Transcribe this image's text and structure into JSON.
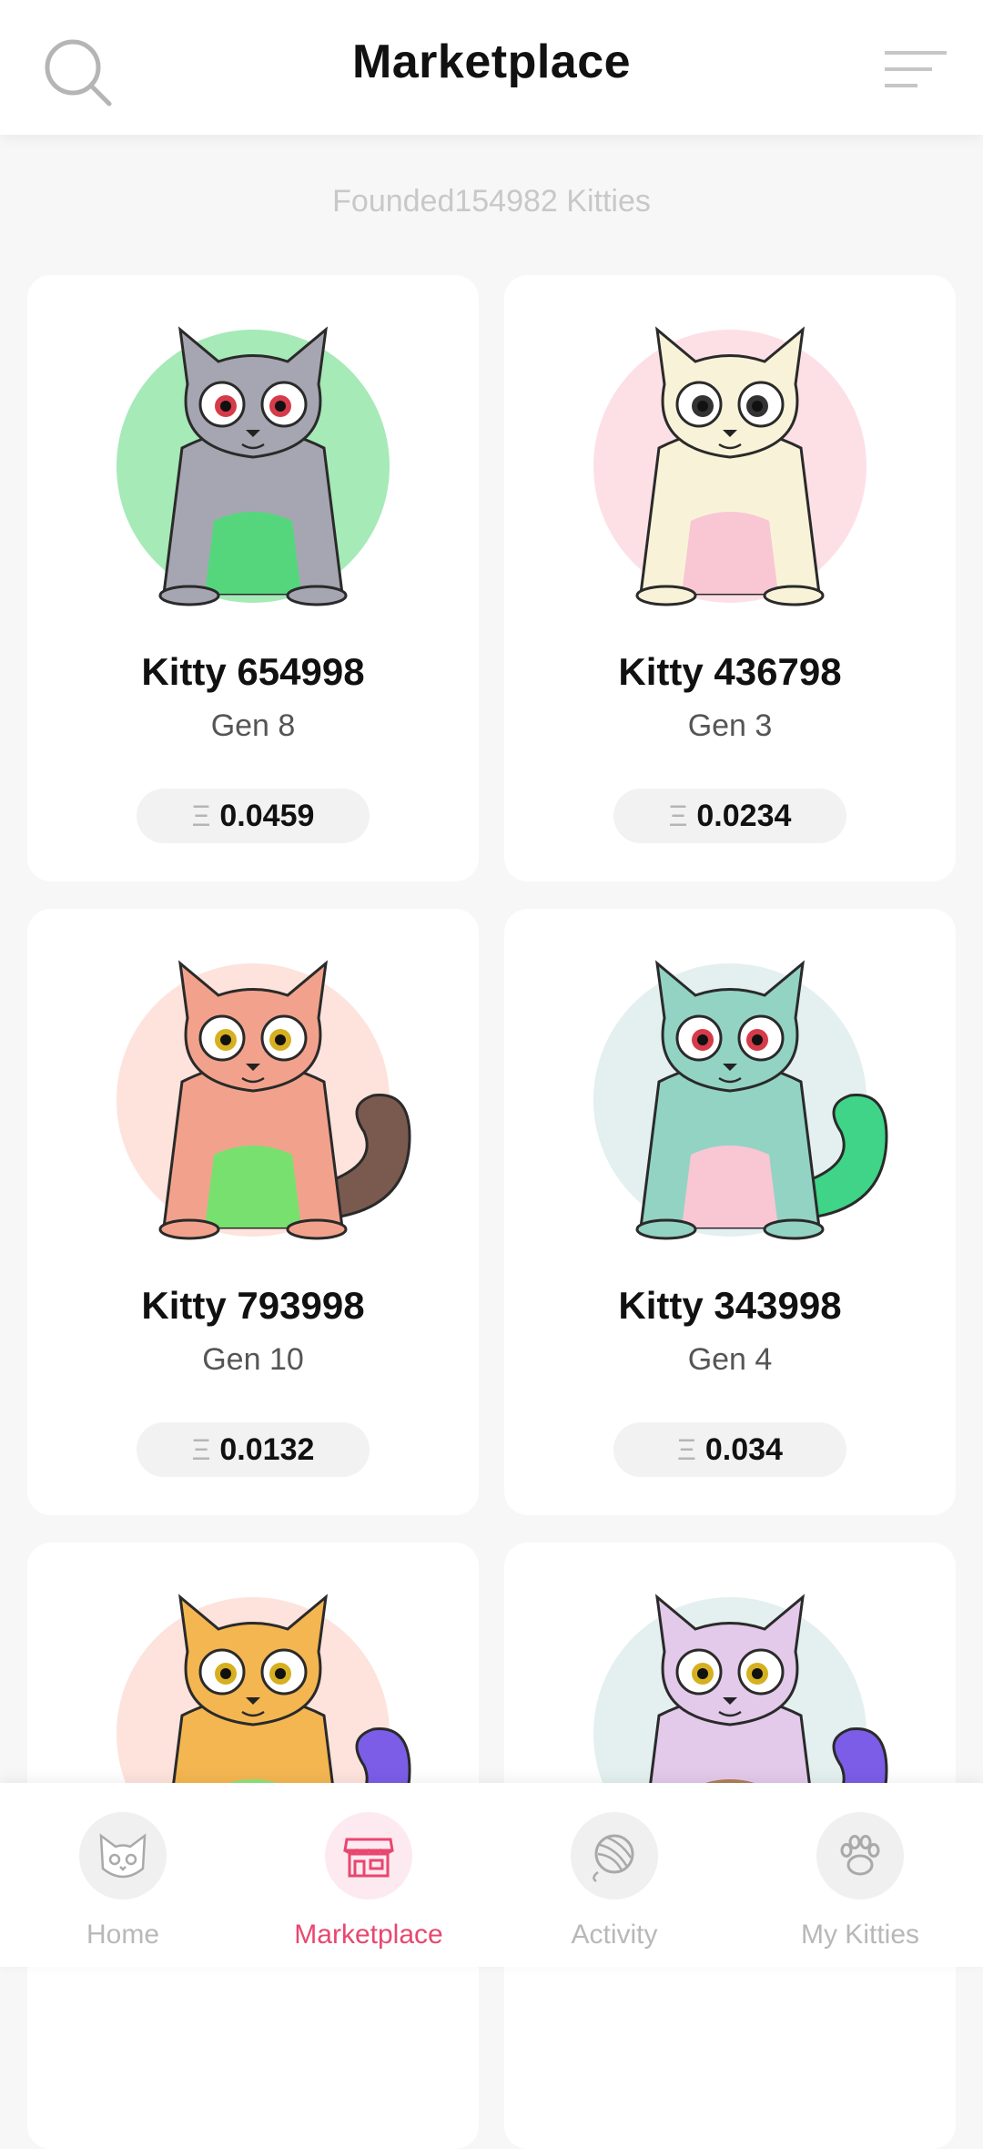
{
  "header": {
    "title": "Marketplace"
  },
  "summary": {
    "founded_text": "Founded154982 Kitties"
  },
  "currency_symbol": "Ξ",
  "kitties": [
    {
      "name": "Kitty 654998",
      "gen": "Gen 8",
      "price": "0.0459",
      "bg": "#a6eab7",
      "body": "#a6a6b2",
      "belly": "#55d67d",
      "accent": "#3ecf86",
      "eye": "#d63b4a"
    },
    {
      "name": "Kitty 436798",
      "gen": "Gen 3",
      "price": "0.0234",
      "bg": "#fde0e6",
      "body": "#f8f3d8",
      "belly": "#f9c6d4",
      "accent": "#333333",
      "eye": "#333333"
    },
    {
      "name": "Kitty 793998",
      "gen": "Gen 10",
      "price": "0.0132",
      "bg": "#fde3dc",
      "body": "#f2a28c",
      "belly": "#78e06f",
      "accent": "#7a5a4f",
      "eye": "#d6b020"
    },
    {
      "name": "Kitty 343998",
      "gen": "Gen 4",
      "price": "0.034",
      "bg": "#e3f0ef",
      "body": "#93d3c3",
      "belly": "#f9c6d4",
      "accent": "#3fd487",
      "eye": "#d63b4a"
    },
    {
      "name": "",
      "gen": "",
      "price": "",
      "bg": "#fde3dc",
      "body": "#f4b651",
      "belly": "#8be57a",
      "accent": "#7b5de8",
      "eye": "#d6b020"
    },
    {
      "name": "",
      "gen": "",
      "price": "",
      "bg": "#e3f0ef",
      "body": "#e3c9ea",
      "belly": "#b27d58",
      "accent": "#7b5de8",
      "eye": "#d6b020"
    }
  ],
  "tabs": [
    {
      "label": "Home",
      "icon": "cat-face-icon",
      "active": false
    },
    {
      "label": "Marketplace",
      "icon": "storefront-icon",
      "active": true
    },
    {
      "label": "Activity",
      "icon": "yarn-ball-icon",
      "active": false
    },
    {
      "label": "My Kitties",
      "icon": "paw-icon",
      "active": false
    }
  ],
  "colors": {
    "accent": "#e8476f",
    "inactive": "#b8b8b8"
  }
}
